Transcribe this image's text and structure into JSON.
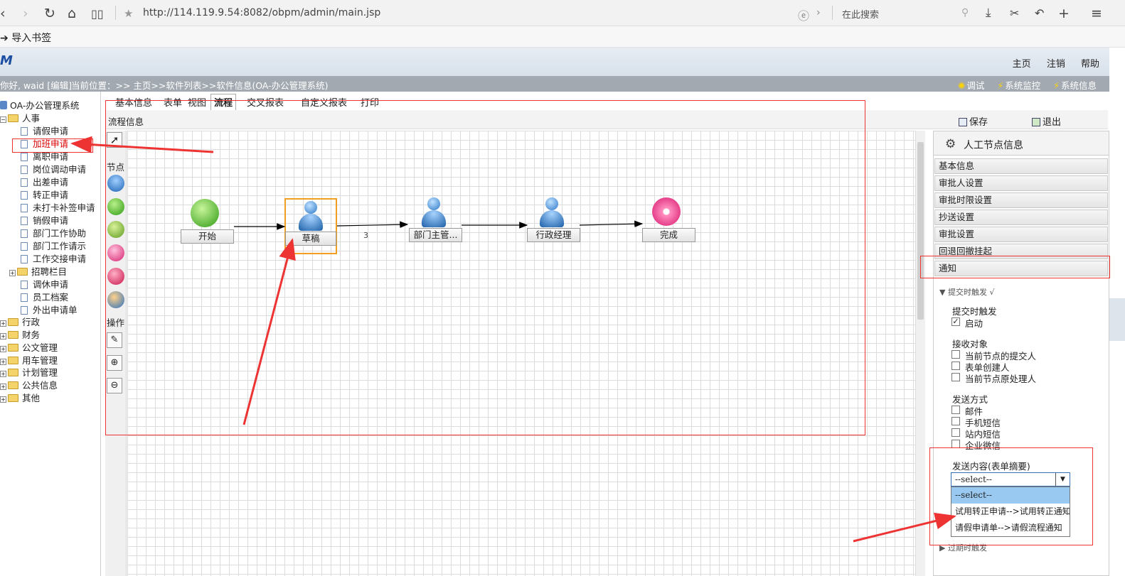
{
  "browser": {
    "url": "http://114.119.9.54:8082/obpm/admin/main.jsp",
    "search_placeholder": "在此搜索",
    "bookmark_label": "导入书签"
  },
  "app": {
    "logo_text": "M",
    "top_links": [
      "主页",
      "注销",
      "帮助"
    ],
    "greeting": "你好, waid [编辑]",
    "location": "当前位置：>> 主页>>软件列表>>软件信息(OA-办公管理系统)",
    "tools": [
      "调试",
      "系统监控",
      "系统信息"
    ]
  },
  "sidebar": {
    "root": "OA-办公管理系统",
    "group_hr": "人事",
    "hr_items": [
      "请假申请",
      "加班申请",
      "离职申请",
      "岗位调动申请",
      "出差申请",
      "转正申请",
      "未打卡补签申请",
      "销假申请",
      "部门工作协助",
      "部门工作请示",
      "工作交接申请",
      "招聘栏目",
      "调休申请",
      "员工档案",
      "外出申请单"
    ],
    "groups": [
      "行政",
      "财务",
      "公文管理",
      "用车管理",
      "计划管理",
      "公共信息",
      "其他"
    ]
  },
  "tabs": [
    "基本信息",
    "表单",
    "视图",
    "流程",
    "交叉报表",
    "自定义报表",
    "打印"
  ],
  "toolbar": {
    "title": "流程信息",
    "save": "保存",
    "exit": "退出"
  },
  "palette": {
    "nodes_label": "节点",
    "ops_label": "操作"
  },
  "flow": {
    "nodes": [
      "开始",
      "草稿",
      "部门主管...",
      "行政经理",
      "完成"
    ],
    "edge_label": "3"
  },
  "rpanel": {
    "title": "人工节点信息",
    "items": [
      "基本信息",
      "审批人设置",
      "审批时限设置",
      "抄送设置",
      "审批设置",
      "回退回撤挂起",
      "通知"
    ],
    "section_submit": "▼ 提交时触发 √",
    "trigger_label": "提交时触发",
    "enable_label": "启动",
    "receiver_label": "接收对象",
    "receivers": [
      "当前节点的提交人",
      "表单创建人",
      "当前节点原处理人"
    ],
    "send_method_label": "发送方式",
    "send_methods": [
      "邮件",
      "手机短信",
      "站内短信",
      "企业微信"
    ],
    "content_label": "发送内容(表单摘要)",
    "select_value": "--select--",
    "options": [
      "--select--",
      "试用转正申请-->试用转正通知",
      "请假申请单-->请假流程通知"
    ],
    "section_overdue": "▶ 过期时触发"
  }
}
